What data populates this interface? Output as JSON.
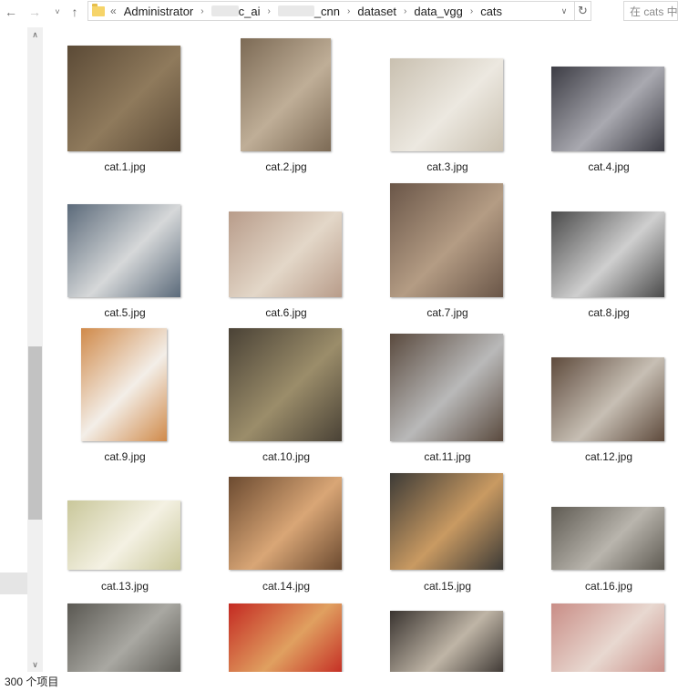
{
  "nav": {
    "back_icon": "←",
    "forward_icon": "→",
    "recent_icon": "˅",
    "up_icon": "↑"
  },
  "address": {
    "overflow": "«",
    "crumbs": [
      "Administrator",
      "c_ai",
      "_cnn",
      "dataset",
      "data_vgg",
      "cats"
    ],
    "dropdown_icon": "∨",
    "refresh_icon": "↻"
  },
  "search": {
    "placeholder": "在 cats 中搜索"
  },
  "files": [
    {
      "name": "cat.1.jpg",
      "colors": [
        "#5b4a36",
        "#8f7a5c"
      ]
    },
    {
      "name": "cat.2.jpg",
      "colors": [
        "#7c6a55",
        "#bfae97"
      ]
    },
    {
      "name": "cat.3.jpg",
      "colors": [
        "#c9c0b0",
        "#ece8e0"
      ]
    },
    {
      "name": "cat.4.jpg",
      "colors": [
        "#3c3c44",
        "#a9a9b0"
      ]
    },
    {
      "name": "cat.5.jpg",
      "colors": [
        "#5b6a7a",
        "#d6d8d9"
      ]
    },
    {
      "name": "cat.6.jpg",
      "colors": [
        "#b89c8a",
        "#e3d7c8"
      ]
    },
    {
      "name": "cat.7.jpg",
      "colors": [
        "#6a5648",
        "#b49c84"
      ]
    },
    {
      "name": "cat.8.jpg",
      "colors": [
        "#4a4a4a",
        "#cfcfcf"
      ]
    },
    {
      "name": "cat.9.jpg",
      "colors": [
        "#d08a4a",
        "#f3eee8"
      ]
    },
    {
      "name": "cat.10.jpg",
      "colors": [
        "#4a4236",
        "#9b8d6a"
      ]
    },
    {
      "name": "cat.11.jpg",
      "colors": [
        "#5a4a3e",
        "#b9b9b9"
      ]
    },
    {
      "name": "cat.12.jpg",
      "colors": [
        "#5e4a3c",
        "#c7bfb4"
      ]
    },
    {
      "name": "cat.13.jpg",
      "colors": [
        "#c9c79a",
        "#f4f1e3"
      ]
    },
    {
      "name": "cat.14.jpg",
      "colors": [
        "#6b4a30",
        "#d9a676"
      ]
    },
    {
      "name": "cat.15.jpg",
      "colors": [
        "#3c3a36",
        "#c99a62"
      ]
    },
    {
      "name": "cat.16.jpg",
      "colors": [
        "#5e5a52",
        "#b9b5ad"
      ]
    },
    {
      "name": "",
      "colors": [
        "#5a5852",
        "#a9a8a2"
      ]
    },
    {
      "name": "",
      "colors": [
        "#c42a22",
        "#e0a060"
      ]
    },
    {
      "name": "",
      "colors": [
        "#3a3430",
        "#bfb5a6"
      ]
    },
    {
      "name": "",
      "colors": [
        "#c98d86",
        "#e8d8d0"
      ]
    }
  ],
  "scrollbar": {
    "up_icon": "∧",
    "down_icon": "∨"
  },
  "status": {
    "count_text": "300 个项目"
  }
}
